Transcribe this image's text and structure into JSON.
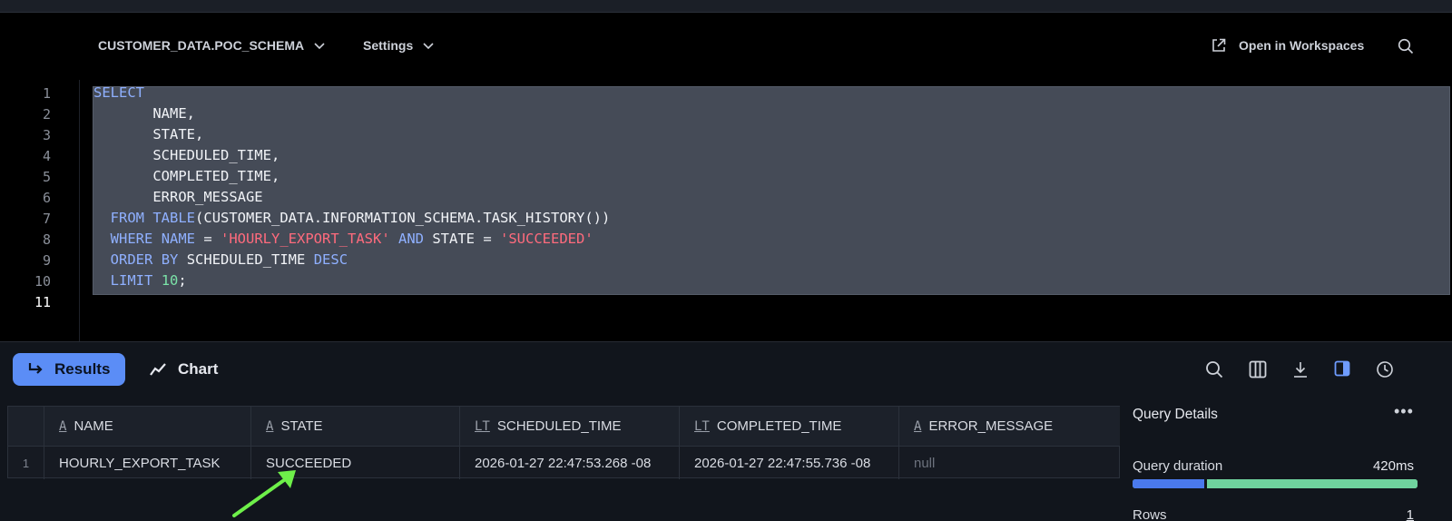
{
  "topbar": {
    "database": "CUSTOMER_DATA.POC_SCHEMA",
    "settings": "Settings",
    "open_in_workspaces": "Open in Workspaces"
  },
  "editor": {
    "line_numbers": [
      "1",
      "2",
      "3",
      "4",
      "5",
      "6",
      "7",
      "8",
      "9",
      "10",
      "11"
    ],
    "active_line": "11",
    "code": [
      "SELECT",
      "NAME,",
      "STATE,",
      "SCHEDULED_TIME,",
      "COMPLETED_TIME,",
      "ERROR_MESSAGE",
      "FROM TABLE(CUSTOMER_DATA.INFORMATION_SCHEMA.TASK_HISTORY())",
      "WHERE NAME = 'HOURLY_EXPORT_TASK' AND STATE = 'SUCCEEDED'",
      "ORDER BY SCHEDULED_TIME DESC",
      "LIMIT 10;"
    ]
  },
  "results": {
    "tabs": {
      "results": "Results",
      "chart": "Chart"
    },
    "columns": [
      {
        "name": "NAME",
        "type_icon": "A"
      },
      {
        "name": "STATE",
        "type_icon": "A"
      },
      {
        "name": "SCHEDULED_TIME",
        "type_icon": "LT"
      },
      {
        "name": "COMPLETED_TIME",
        "type_icon": "LT"
      },
      {
        "name": "ERROR_MESSAGE",
        "type_icon": "A"
      }
    ],
    "rows": [
      {
        "row_number": "1",
        "cells": [
          "HOURLY_EXPORT_TASK",
          "SUCCEEDED",
          "2026-01-27 22:47:53.268 -08",
          "2026-01-27 22:47:55.736 -08",
          "null"
        ]
      }
    ]
  },
  "query_details": {
    "title": "Query Details",
    "duration_label": "Query duration",
    "duration_value": "420ms",
    "rows_label": "Rows",
    "rows_value": "1",
    "duration_split_fraction": 0.25
  },
  "colors": {
    "accent": "#5b8df6",
    "keyword": "#8fb0ff",
    "string": "#ff6b7d",
    "number": "#7be3a8",
    "annotation_arrow": "#6ef04a"
  }
}
